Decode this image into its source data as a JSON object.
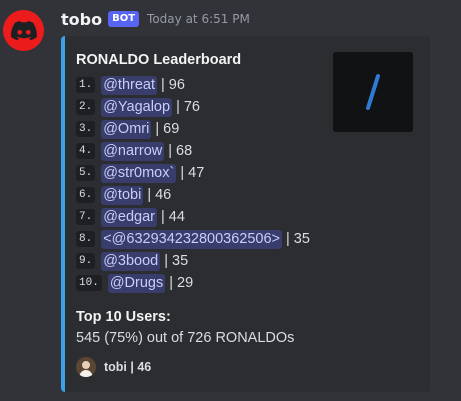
{
  "message": {
    "author": "tobo",
    "badge": "BOT",
    "timestamp": "Today at 6:51 PM"
  },
  "embed": {
    "accent_color": "#3ba2e8",
    "title": "RONALDO Leaderboard",
    "thumbnail_icon": "slash-icon",
    "entries": [
      {
        "rank": "1.",
        "user": "@threat",
        "score": "| 96"
      },
      {
        "rank": "2.",
        "user": "@Yagalop",
        "score": "| 76"
      },
      {
        "rank": "3.",
        "user": "@Omri",
        "score": "| 69"
      },
      {
        "rank": "4.",
        "user": "@narrow",
        "score": "| 68"
      },
      {
        "rank": "5.",
        "user": "@str0mox`",
        "score": "| 47"
      },
      {
        "rank": "6.",
        "user": "@tobi",
        "score": "| 46"
      },
      {
        "rank": "7.",
        "user": "@edgar",
        "score": "| 44"
      },
      {
        "rank": "8.",
        "user": "<@632934232800362506>",
        "score": "| 35"
      },
      {
        "rank": "9.",
        "user": "@3bood",
        "score": "| 35"
      },
      {
        "rank": "10.",
        "user": "@Drugs",
        "score": "| 29"
      }
    ],
    "summary_label": "Top 10 Users:",
    "summary_value": "545 (75%) out of 726 RONALDOs",
    "footer_text": "tobi | 46"
  }
}
